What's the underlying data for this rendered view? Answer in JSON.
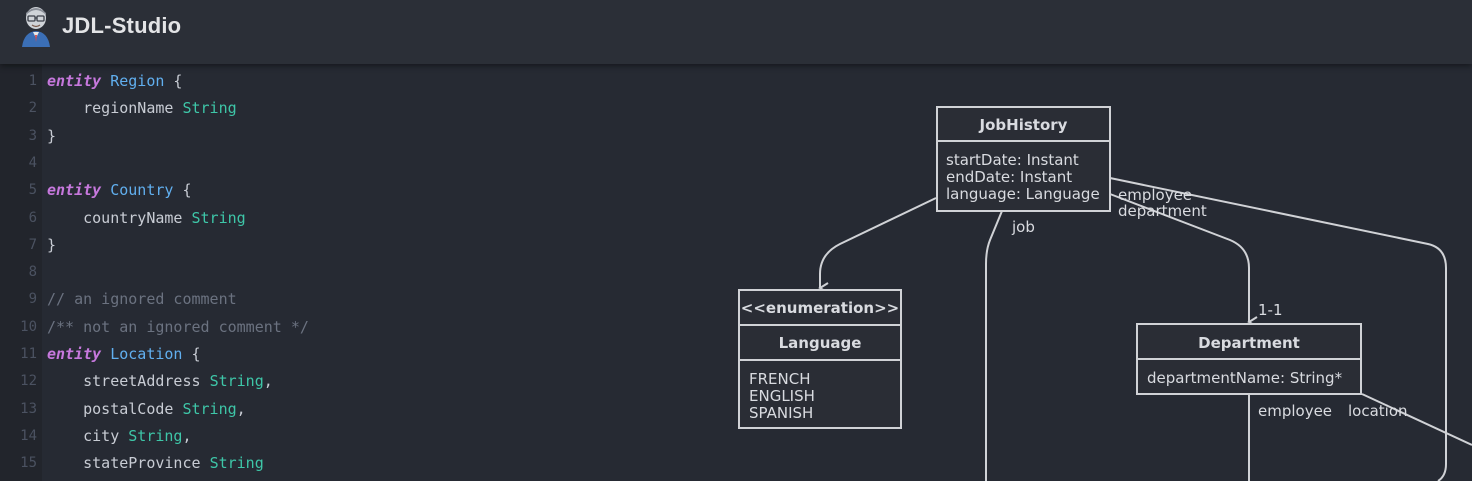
{
  "app": {
    "title": "JDL-Studio"
  },
  "editor": {
    "lines": [
      {
        "n": "1",
        "tokens": [
          {
            "t": "kw",
            "v": "entity"
          },
          {
            "t": "sp",
            "v": " "
          },
          {
            "t": "ent",
            "v": "Region"
          },
          {
            "t": "br",
            "v": " {"
          }
        ]
      },
      {
        "n": "2",
        "tokens": [
          {
            "t": "sp",
            "v": "    regionName "
          },
          {
            "t": "typ",
            "v": "String"
          }
        ]
      },
      {
        "n": "3",
        "tokens": [
          {
            "t": "br",
            "v": "}"
          }
        ]
      },
      {
        "n": "4",
        "tokens": []
      },
      {
        "n": "5",
        "tokens": [
          {
            "t": "kw",
            "v": "entity"
          },
          {
            "t": "sp",
            "v": " "
          },
          {
            "t": "ent",
            "v": "Country"
          },
          {
            "t": "br",
            "v": " {"
          }
        ]
      },
      {
        "n": "6",
        "tokens": [
          {
            "t": "sp",
            "v": "    countryName "
          },
          {
            "t": "typ",
            "v": "String"
          }
        ]
      },
      {
        "n": "7",
        "tokens": [
          {
            "t": "br",
            "v": "}"
          }
        ]
      },
      {
        "n": "8",
        "tokens": []
      },
      {
        "n": "9",
        "tokens": [
          {
            "t": "cm",
            "v": "// an ignored comment"
          }
        ]
      },
      {
        "n": "10",
        "tokens": [
          {
            "t": "cm",
            "v": "/** not an ignored comment */"
          }
        ]
      },
      {
        "n": "11",
        "tokens": [
          {
            "t": "kw",
            "v": "entity"
          },
          {
            "t": "sp",
            "v": " "
          },
          {
            "t": "ent",
            "v": "Location"
          },
          {
            "t": "br",
            "v": " {"
          }
        ]
      },
      {
        "n": "12",
        "tokens": [
          {
            "t": "sp",
            "v": "    streetAddress "
          },
          {
            "t": "typ",
            "v": "String"
          },
          {
            "t": "br",
            "v": ","
          }
        ]
      },
      {
        "n": "13",
        "tokens": [
          {
            "t": "sp",
            "v": "    postalCode "
          },
          {
            "t": "typ",
            "v": "String"
          },
          {
            "t": "br",
            "v": ","
          }
        ]
      },
      {
        "n": "14",
        "tokens": [
          {
            "t": "sp",
            "v": "    city "
          },
          {
            "t": "typ",
            "v": "String"
          },
          {
            "t": "br",
            "v": ","
          }
        ]
      },
      {
        "n": "15",
        "tokens": [
          {
            "t": "sp",
            "v": "    stateProvince "
          },
          {
            "t": "typ",
            "v": "String"
          }
        ]
      }
    ]
  },
  "diagram": {
    "jobHistory": {
      "title": "JobHistory",
      "fields": [
        "startDate: Instant",
        "endDate: Instant",
        "language: Language"
      ]
    },
    "language": {
      "stereotype": "<<enumeration>>",
      "title": "Language",
      "values": [
        "FRENCH",
        "ENGLISH",
        "SPANISH"
      ]
    },
    "department": {
      "title": "Department",
      "fields": [
        "departmentName: String*"
      ]
    },
    "labels": {
      "employee": "employee",
      "department": "department",
      "job": "job",
      "one_to_one": "1-1",
      "dept_employee": "employee",
      "dept_location": "location"
    }
  },
  "colors": {
    "background": "#262a33",
    "header": "#2b2f37",
    "keyword": "#c678dd",
    "entity": "#61afef",
    "type": "#3ec6a8",
    "comment": "#6b7280",
    "diagram_line": "#d0d2d6"
  }
}
